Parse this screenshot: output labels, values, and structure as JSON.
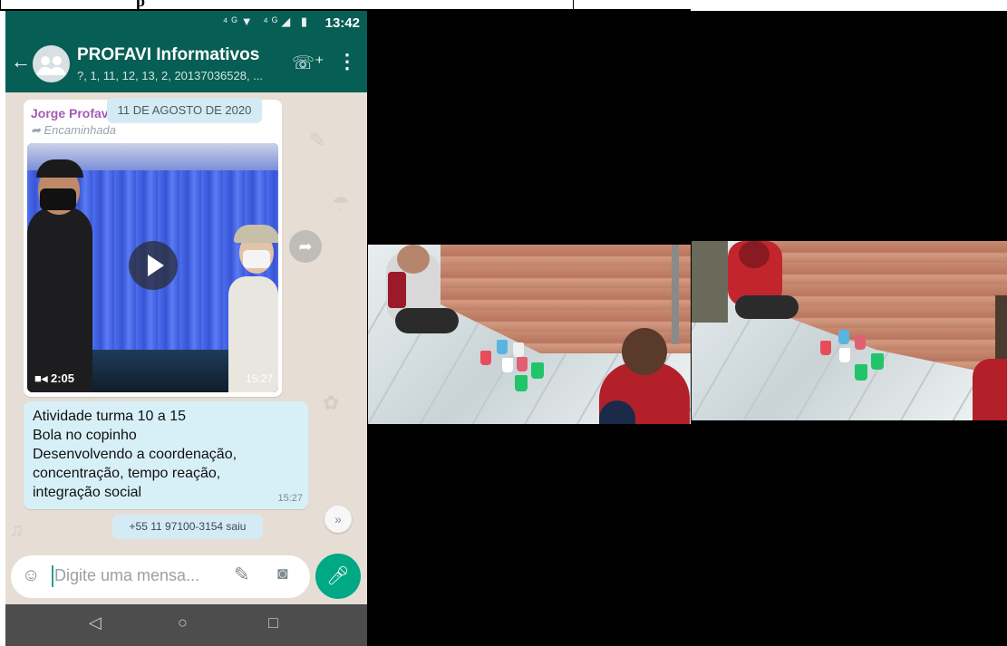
{
  "doc": {
    "heading_fragment": "p"
  },
  "status_bar": {
    "time": "13:42",
    "icons": "⁴ᴳ▼ ⁴ᴳ◢ ▮"
  },
  "header": {
    "back_icon": "arrow-left-icon",
    "title": "PROFAVI Informativos",
    "subtitle": "?, 1, 11, 12, 13, 2, 20137036528, ...",
    "call_icon": "add-call-icon",
    "menu_icon": "more-vert-icon"
  },
  "messages": {
    "date_chip": "11 DE AGOSTO DE 2020",
    "media": {
      "sender": "Jorge Profav",
      "forwarded": "Encaminhada",
      "duration": "2:05",
      "time": "15:27"
    },
    "text": {
      "lines": [
        "Atividade turma 10 a 15",
        "Bola no copinho",
        "Desenvolvendo  a coordenação,",
        "concentração, tempo reação,",
        "integração social"
      ],
      "time": "15:27"
    },
    "system": "+55 11 97100-3154 saiu"
  },
  "composer": {
    "placeholder": "Digite uma mensa...",
    "emoji_icon": "emoji-icon",
    "attach_icon": "paperclip-icon",
    "camera_icon": "camera-icon",
    "mic_icon": "mic-icon"
  },
  "navbar": {
    "back": "◁",
    "home": "○",
    "recents": "□"
  },
  "colors": {
    "header": "#075e54",
    "accent": "#00a884",
    "bubble": "#d7f0f8",
    "chat_bg": "#e6ded5"
  }
}
